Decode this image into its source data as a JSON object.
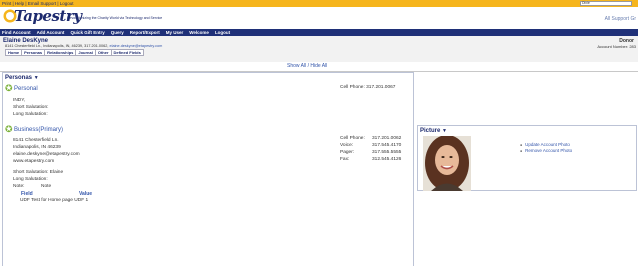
{
  "topbar": {
    "links": "Print | Help | Email Support | Logout",
    "search_value": "Dixie"
  },
  "header": {
    "logo": "Tapestry",
    "tagline": "Revolutionizing the Charity World via Technology and Service",
    "support_link": "All Support Gr"
  },
  "main_tabs": [
    "Main",
    "Communicate",
    "Mass Update",
    "Reporting",
    "Manage",
    "Help"
  ],
  "subnav": [
    "Find Account",
    "Add Account",
    "Quick Gift Entry",
    "Query",
    "Report/Export",
    "My User",
    "Welcome",
    "Logout"
  ],
  "contact": {
    "name": "Elaine DesKyne",
    "address": "8141 Chesterfield Ln., Indianapolis, IN, 46239, 317.201.0062, ",
    "email": "elaine.deskyne@etapestry.com",
    "tabs": [
      "Home",
      "Personas",
      "Relationships",
      "Journal",
      "Other",
      "Defined Fields"
    ],
    "donor_type": "Donor",
    "account_number": "Account Number: 283"
  },
  "show_all": "Show All / Hide All",
  "personas_panel": {
    "title": "Personas",
    "personal": {
      "title": "Personal",
      "lines": [
        "INDY,",
        "Short Salutation:",
        "Long Salutation:"
      ],
      "cell_phone": "Cell Phone: 317.201.0067"
    },
    "business": {
      "title": "Business(Primary)",
      "lines": [
        "8141 Chesterfield Ln.",
        "Indianapolis, IN 46239",
        "elaine.deskyne@etapestry.com",
        "www.etapestry.com"
      ],
      "phones": [
        {
          "label": "Cell Phone:",
          "value": "317.201.0062"
        },
        {
          "label": "Voice:",
          "value": "317.545.4170"
        },
        {
          "label": "Pager:",
          "value": "317.555.5555"
        },
        {
          "label": "Fax:",
          "value": "312.545.4126"
        }
      ],
      "salutations": [
        "Short Salutation: Elaine",
        "Long Salutation:"
      ],
      "note_label": "Note:",
      "note_value": "Note"
    },
    "defined_fields": {
      "field_header": "Field",
      "value_header": "Value",
      "row": "UDF Test for Home page UDF 1"
    }
  },
  "picture_panel": {
    "title": "Picture",
    "links": [
      "Update Account Photo",
      "Remove Account Photo"
    ]
  },
  "colors": {
    "topbar": "#f6b51c",
    "navy": "#1f3078",
    "link": "#3355aa",
    "star_green": "#7bb13a"
  }
}
